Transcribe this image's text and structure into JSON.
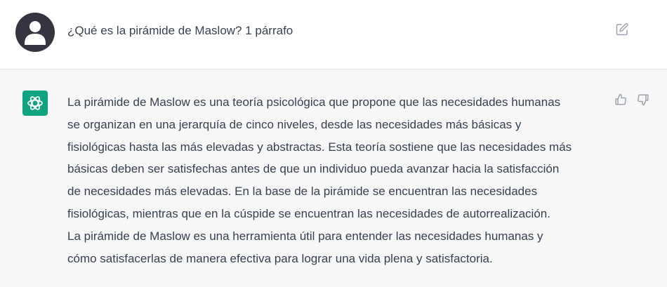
{
  "user_message": {
    "text": "¿Qué es la pirámide de Maslow? 1 párrafo",
    "avatar_icon": "user-avatar-icon",
    "edit_icon": "edit-icon"
  },
  "assistant_message": {
    "logo_icon": "openai-logo-icon",
    "lines": [
      "La pirámide de Maslow es una teoría psicológica que propone que las necesidades humanas",
      "se organizan en una jerarquía de cinco niveles, desde las necesidades más básicas y",
      "fisiológicas hasta las más elevadas y abstractas. Esta teoría sostiene que las necesidades más",
      "básicas deben ser satisfechas antes de que un individuo pueda avanzar hacia la satisfacción",
      "de necesidades más elevadas. En la base de la pirámide se encuentran las necesidades",
      "fisiológicas, mientras que en la cúspide se encuentran las necesidades de autorrealización.",
      "La pirámide de Maslow es una herramienta útil para entender las necesidades humanas y",
      "cómo satisfacerlas de manera efectiva para lograr una vida plena y satisfactoria."
    ],
    "feedback_icons": [
      "thumbs-up-icon",
      "thumbs-down-icon"
    ]
  },
  "colors": {
    "assistant_bg": "#f7f7f8",
    "logo_bg": "#10a37f",
    "avatar_bg": "#343541",
    "text": "#374151"
  }
}
